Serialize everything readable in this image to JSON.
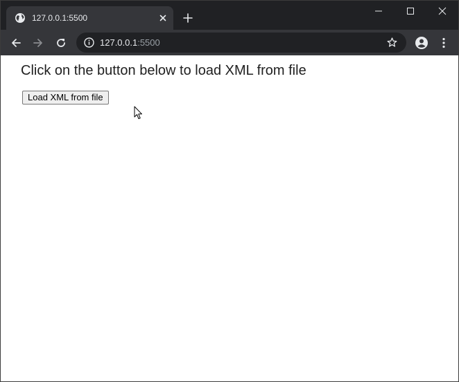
{
  "tab": {
    "title": "127.0.0.1:5500",
    "favicon": "globe-icon",
    "close_icon": "close-icon",
    "new_tab_icon": "plus-icon"
  },
  "window_controls": {
    "minimize_icon": "minimize-icon",
    "maximize_icon": "maximize-icon",
    "close_icon": "close-icon"
  },
  "toolbar": {
    "back_icon": "back-arrow-icon",
    "forward_icon": "forward-arrow-icon",
    "reload_icon": "reload-icon",
    "profile_icon": "account-icon",
    "menu_icon": "more-vertical-icon"
  },
  "omnibox": {
    "site_info_icon": "info-icon",
    "host": "127.0.0.1",
    "port": ":5500",
    "bookmark_icon": "star-icon"
  },
  "page": {
    "heading": "Click on the button below to load XML from file",
    "button_label": "Load XML from file"
  },
  "colors": {
    "titlebar": "#202124",
    "tab_active": "#35363a",
    "omnibox_bg": "#202124",
    "text_light": "#e8eaed",
    "text_dim": "#9aa0a6"
  }
}
